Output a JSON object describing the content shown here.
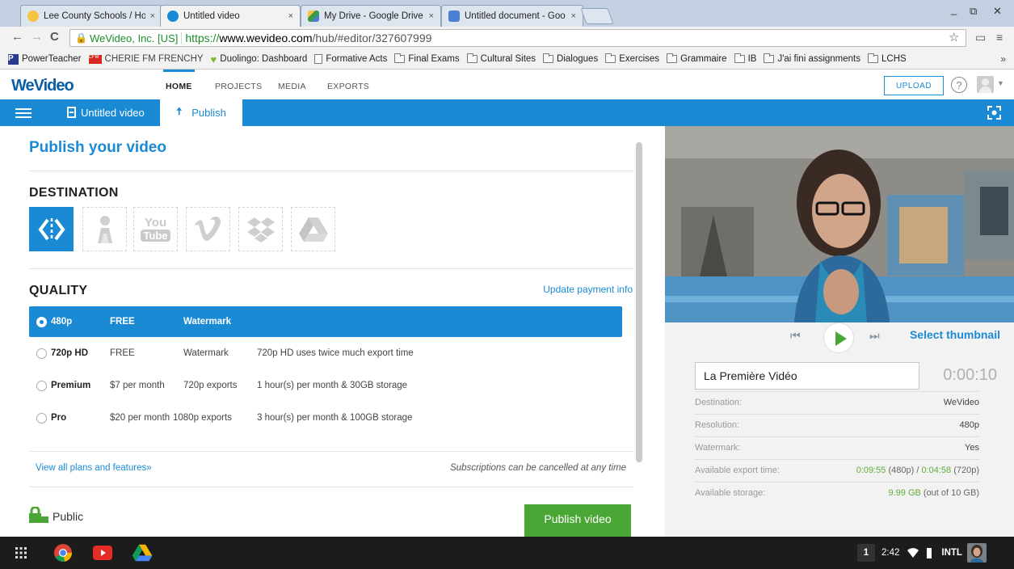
{
  "browser": {
    "tabs": [
      {
        "title": "Lee County Schools / Hom",
        "close": "×",
        "color": "#f5c445"
      },
      {
        "title": "Untitled video",
        "close": "×",
        "color": "#1a8ad4"
      },
      {
        "title": "My Drive - Google Drive",
        "close": "×",
        "color": "#3a9a4b"
      },
      {
        "title": "Untitled document - Goo",
        "close": "×",
        "color": "#4b7fd6"
      }
    ],
    "window_controls": [
      "_",
      "⧉",
      "✕"
    ],
    "address": {
      "ev_label": "WeVideo, Inc. [US]",
      "scheme": "https://",
      "host": "www.wevideo.com",
      "path": "/hub/#editor/327607999"
    },
    "bookmarks": [
      {
        "label": "PowerTeacher",
        "icon": "powerteacher-icon"
      },
      {
        "label": "CHERIE FM FRENCHY",
        "icon": "cherie-fm-icon"
      },
      {
        "label": "Duolingo: Dashboard",
        "icon": "duolingo-icon"
      },
      {
        "label": "Formative Acts",
        "icon": "document-icon"
      },
      {
        "label": "Final Exams",
        "icon": "folder-icon"
      },
      {
        "label": "Cultural Sites",
        "icon": "folder-icon"
      },
      {
        "label": "Dialogues",
        "icon": "folder-icon"
      },
      {
        "label": "Exercises",
        "icon": "folder-icon"
      },
      {
        "label": "Grammaire",
        "icon": "folder-icon"
      },
      {
        "label": "IB",
        "icon": "folder-icon"
      },
      {
        "label": "J'ai fini assignments",
        "icon": "folder-icon"
      },
      {
        "label": "LCHS",
        "icon": "folder-icon"
      }
    ],
    "bookmarks_more": "»"
  },
  "app": {
    "logo": "WeVideo",
    "nav": [
      "HOME",
      "PROJECTS",
      "MEDIA",
      "EXPORTS"
    ],
    "active_nav": "HOME",
    "upload_label": "UPLOAD",
    "help_label": "?",
    "project_title": "Untitled video",
    "publish_tab": "Publish",
    "accent": "#1a8ad4",
    "green": "#4aa736"
  },
  "publish": {
    "title": "Publish your video",
    "destination_title": "DESTINATION",
    "destinations": [
      {
        "name": "wevideo",
        "selected": true
      },
      {
        "name": "google-classroom",
        "selected": false
      },
      {
        "name": "youtube",
        "selected": false,
        "text_top": "You",
        "text_bottom": "Tube"
      },
      {
        "name": "vimeo",
        "selected": false
      },
      {
        "name": "dropbox",
        "selected": false
      },
      {
        "name": "google-drive",
        "selected": false
      }
    ],
    "quality_title": "QUALITY",
    "update_payment": "Update payment info",
    "quality_options": [
      {
        "name": "480p",
        "price": "FREE",
        "feature": "Watermark",
        "note": "",
        "selected": true
      },
      {
        "name": "720p HD",
        "price": "FREE",
        "feature": "Watermark",
        "note": "720p HD uses twice much export time",
        "selected": false
      },
      {
        "name": "Premium",
        "price": "$7 per month",
        "feature": "720p exports",
        "note": "1 hour(s) per month & 30GB storage",
        "selected": false
      },
      {
        "name": "Pro",
        "price": "$20 per month",
        "feature": "1080p exports",
        "note": "3 hour(s) per month & 100GB storage",
        "selected": false
      }
    ],
    "view_plans": "View all plans and features»",
    "cancel_note": "Subscriptions can be cancelled at any time",
    "visibility": "Public",
    "publish_button": "Publish video"
  },
  "preview": {
    "select_thumbnail": "Select thumbnail",
    "video_title": "La Première Vidéo",
    "duration": "0:00:10",
    "info": [
      {
        "key": "Destination:",
        "value": "WeVideo"
      },
      {
        "key": "Resolution:",
        "value": "480p"
      },
      {
        "key": "Watermark:",
        "value": "Yes"
      }
    ],
    "export_time": {
      "key": "Available export time:",
      "v480": "0:09:55",
      "l480": " (480p) / ",
      "v720": "0:04:58",
      "l720": " (720p)"
    },
    "storage": {
      "key": "Available storage:",
      "value": "9.99 GB",
      "suffix": " (out of 10 GB)"
    }
  },
  "taskbar": {
    "apps": [
      "app-launcher-icon",
      "chrome-icon",
      "youtube-icon",
      "drive-icon"
    ],
    "notification_count": "1",
    "clock": "2:42",
    "input_method": "INTL"
  }
}
